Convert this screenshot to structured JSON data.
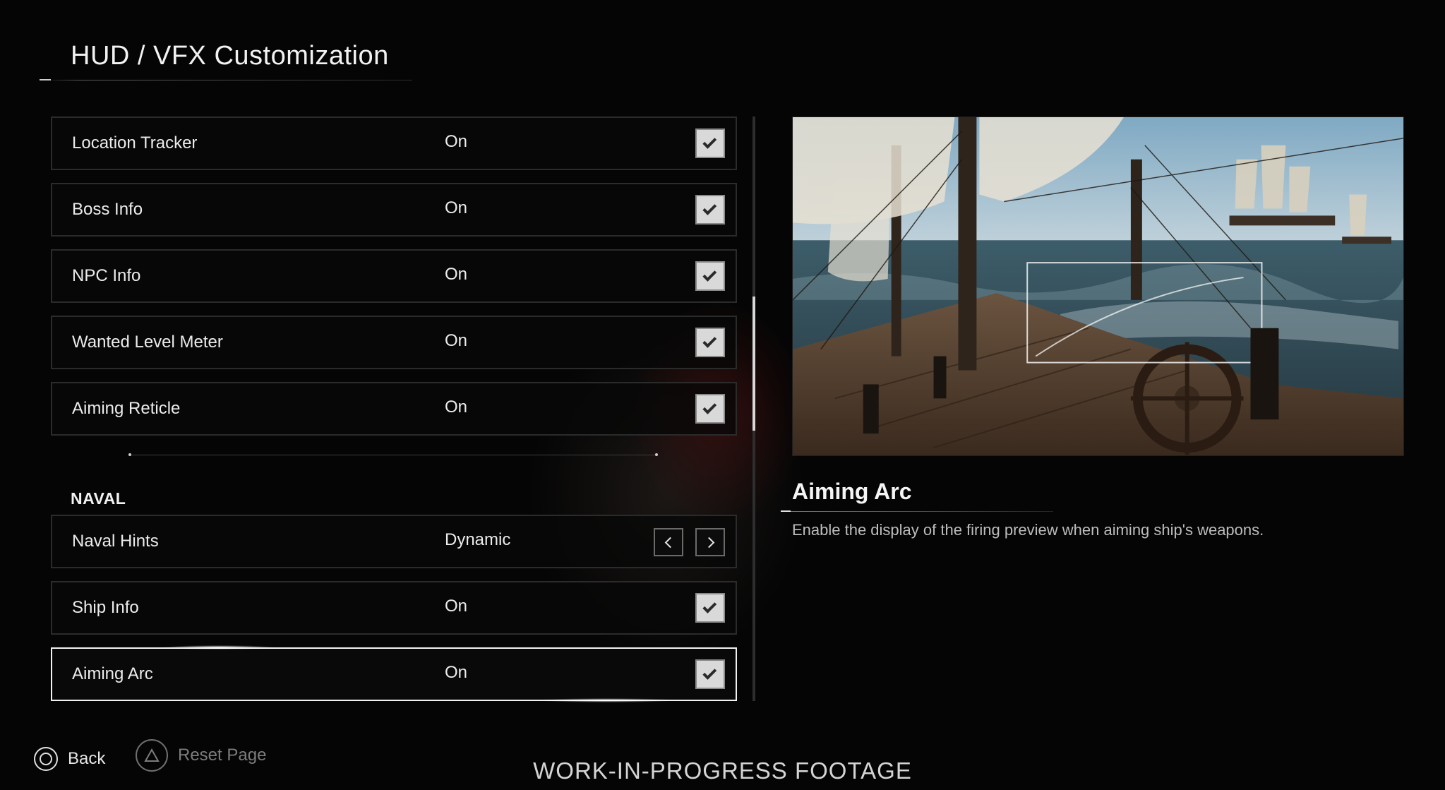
{
  "header": {
    "title": "HUD / VFX Customization"
  },
  "settings": {
    "location_tracker": {
      "label": "Location Tracker",
      "value": "On"
    },
    "boss_info": {
      "label": "Boss Info",
      "value": "On"
    },
    "npc_info": {
      "label": "NPC Info",
      "value": "On"
    },
    "wanted_level_meter": {
      "label": "Wanted Level Meter",
      "value": "On"
    },
    "aiming_reticle": {
      "label": "Aiming Reticle",
      "value": "On"
    }
  },
  "naval": {
    "section_title": "NAVAL",
    "naval_hints": {
      "label": "Naval Hints",
      "value": "Dynamic"
    },
    "ship_info": {
      "label": "Ship Info",
      "value": "On"
    },
    "aiming_arc": {
      "label": "Aiming Arc",
      "value": "On",
      "selected": true
    }
  },
  "detail": {
    "title": "Aiming Arc",
    "description": "Enable the display of the firing preview when aiming ship's weapons."
  },
  "footer": {
    "back_label": "Back",
    "reset_label": "Reset Page",
    "back_icon": "circle-button-icon",
    "reset_icon": "triangle-button-icon"
  },
  "watermark": "WORK-IN-PROGRESS FOOTAGE",
  "colors": {
    "background": "#050505",
    "selected_border": "#f2f2f2",
    "row_border": "#2b2b2b",
    "checkbox_fill": "#d9d9d9"
  }
}
